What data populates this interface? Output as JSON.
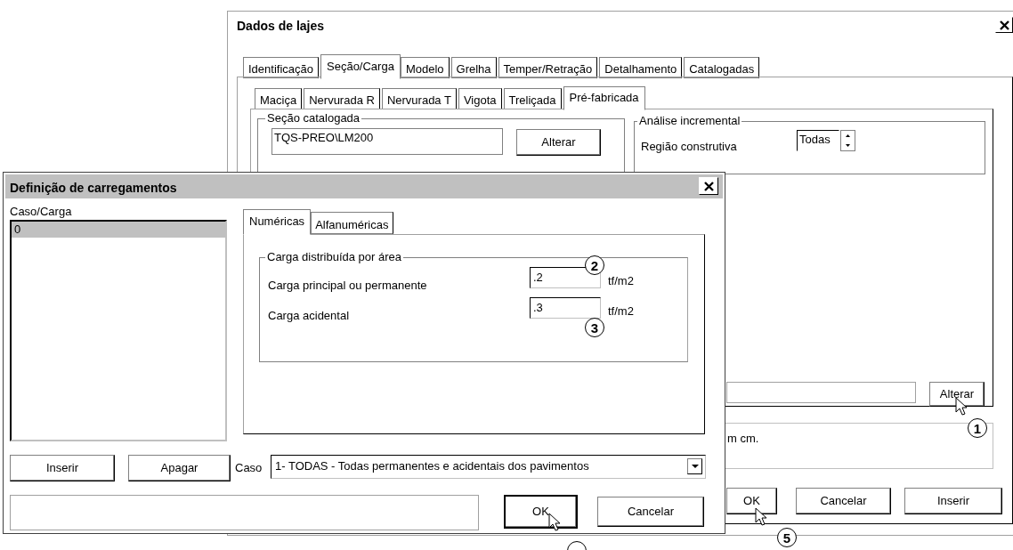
{
  "back_window": {
    "title": "Dados de lajes",
    "tabs": [
      {
        "label": "Identificação",
        "selected": false
      },
      {
        "label": "Seção/Carga",
        "selected": true
      },
      {
        "label": "Modelo",
        "selected": false
      },
      {
        "label": "Grelha",
        "selected": false
      },
      {
        "label": "Temper/Retração",
        "selected": false
      },
      {
        "label": "Detalhamento",
        "selected": false
      },
      {
        "label": "Catalogadas",
        "selected": false
      }
    ],
    "subtabs": [
      {
        "label": "Maciça",
        "selected": false
      },
      {
        "label": "Nervurada R",
        "selected": false
      },
      {
        "label": "Nervurada T",
        "selected": false
      },
      {
        "label": "Vigota",
        "selected": false
      },
      {
        "label": "Treliçada",
        "selected": false
      },
      {
        "label": "Pré-fabricada",
        "selected": true
      }
    ],
    "catalog_group": {
      "title": "Seção catalogada",
      "value": "TQS-PREO\\LM200",
      "button": "Alterar"
    },
    "incremental_group": {
      "title": "Análise incremental",
      "label": "Região construtiva",
      "value": "Todas"
    },
    "lower_button": "Alterar",
    "note": "m cm.",
    "buttons": [
      "OK",
      "Cancelar",
      "Inserir"
    ]
  },
  "front_window": {
    "title": "Definição de carregamentos",
    "list_label": "Caso/Carga",
    "list_items": [
      {
        "label": "0",
        "selected": true
      }
    ],
    "tabs": [
      {
        "label": "Numéricas",
        "selected": true
      },
      {
        "label": "Alfanuméricas",
        "selected": false
      }
    ],
    "group": {
      "title": "Carga distribuída por área",
      "rows": [
        {
          "label": "Carga principal ou permanente",
          "value": ".2",
          "unit": "tf/m2"
        },
        {
          "label": "Carga acidental",
          "value": ".3",
          "unit": "tf/m2"
        }
      ]
    },
    "list_buttons": [
      "Inserir",
      "Apagar"
    ],
    "case_label": "Caso",
    "case_value": "1- TODAS - Todas permanentes e acidentais dos pavimentos",
    "buttons": [
      "OK",
      "Cancelar"
    ]
  },
  "annotations": [
    {
      "label": "1"
    },
    {
      "label": "2"
    },
    {
      "label": "3"
    },
    {
      "label": "5"
    }
  ]
}
